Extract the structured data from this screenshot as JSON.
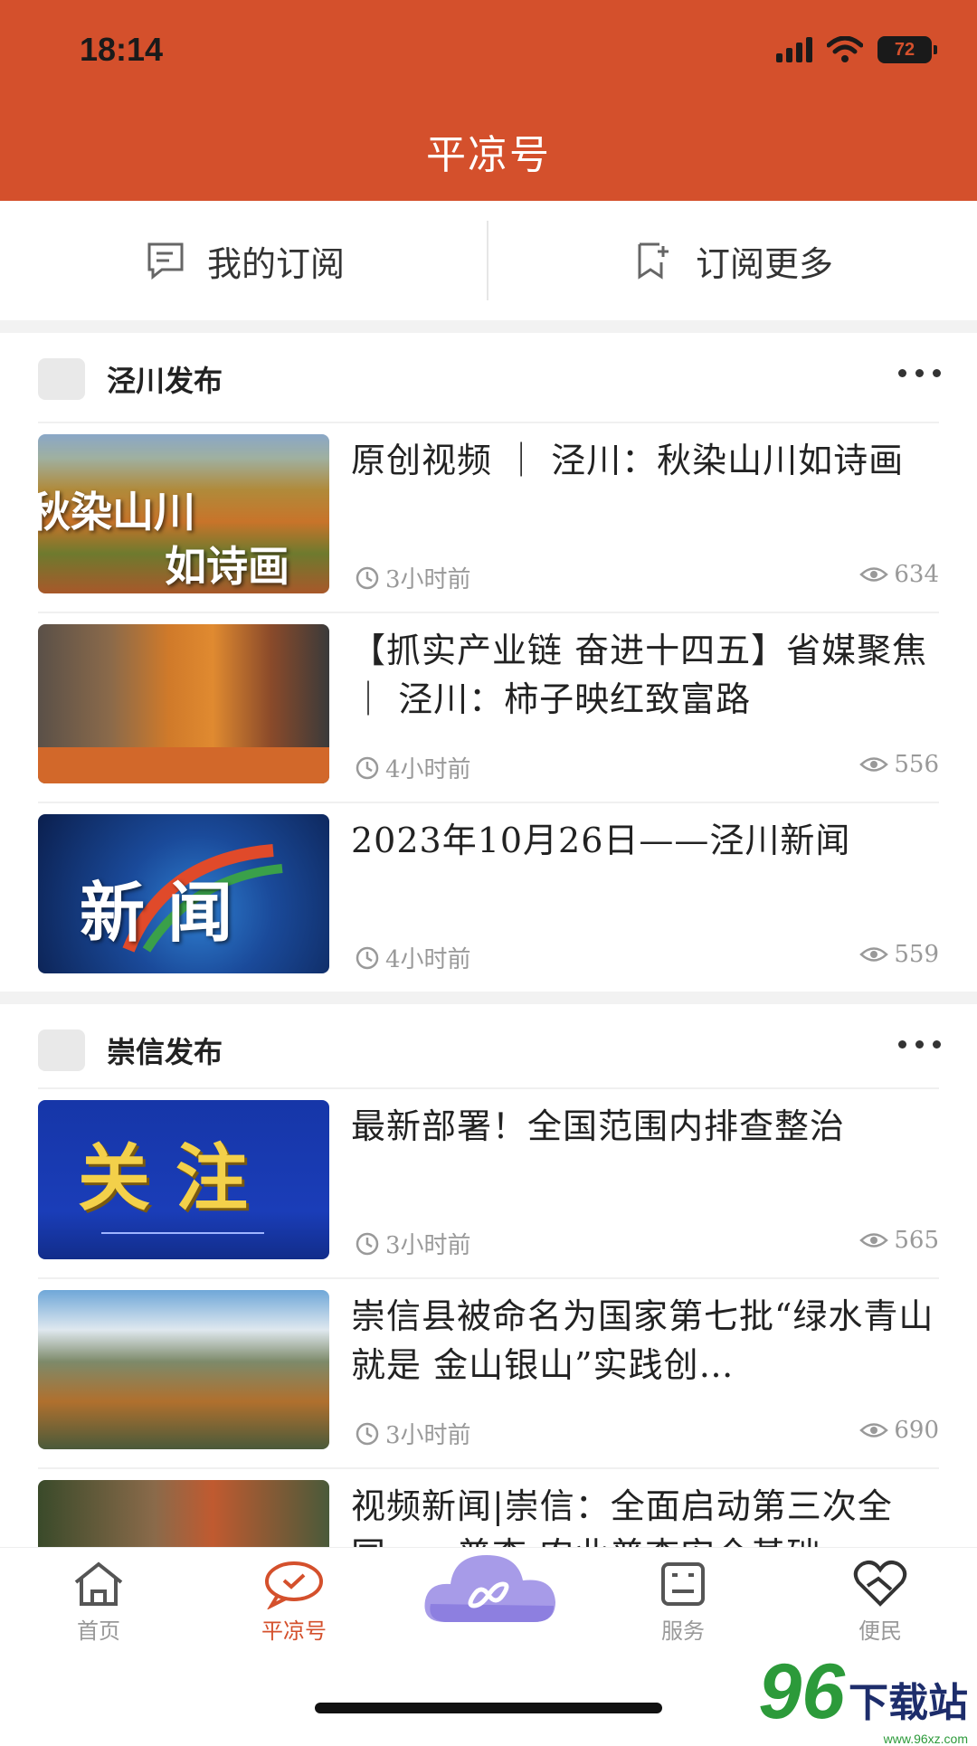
{
  "status_bar": {
    "time": "18:14",
    "battery": "72"
  },
  "header": {
    "title": "平凉号"
  },
  "sub_tabs": [
    {
      "label": "我的订阅",
      "icon": "subscription-list-icon"
    },
    {
      "label": "订阅更多",
      "icon": "add-subscription-icon"
    }
  ],
  "channels": [
    {
      "name": "泾川发布",
      "articles": [
        {
          "title": "原创视频 ｜ 泾川：秋染山川如诗画",
          "time": "3小时前",
          "views": "634",
          "thumb_text": [
            "秋染山川",
            "如诗画"
          ]
        },
        {
          "title": "【抓实产业链 奋进十四五】省媒聚焦 ｜ 泾川：柿子映红致富路",
          "time": "4小时前",
          "views": "556"
        },
        {
          "title": "2023年10月26日——泾川新闻",
          "time": "4小时前",
          "views": "559",
          "thumb_text": [
            "新 闻"
          ]
        }
      ]
    },
    {
      "name": "崇信发布",
      "articles": [
        {
          "title": "最新部署！全国范围内排查整治",
          "time": "3小时前",
          "views": "565",
          "thumb_text": [
            "关 注"
          ]
        },
        {
          "title": "崇信县被命名为国家第七批“绿水青山就是 金山银山”实践创…",
          "time": "3小时前",
          "views": "690"
        },
        {
          "title": "视频新闻|崇信：全面启动第三次全国……普查 农业普查安全基础"
        }
      ]
    }
  ],
  "bottom_nav": [
    {
      "label": "首页",
      "icon": "home-icon"
    },
    {
      "label": "平凉号",
      "icon": "chat-check-icon"
    },
    {
      "label": "",
      "icon": "cloud-center-icon"
    },
    {
      "label": "服务",
      "icon": "service-icon"
    },
    {
      "label": "便民",
      "icon": "heart-hand-icon"
    }
  ],
  "watermark": {
    "number": "96",
    "text": "下载站",
    "url": "www.96xz.com"
  },
  "colors": {
    "brand": "#d4502c",
    "meta_gray": "#999999"
  }
}
